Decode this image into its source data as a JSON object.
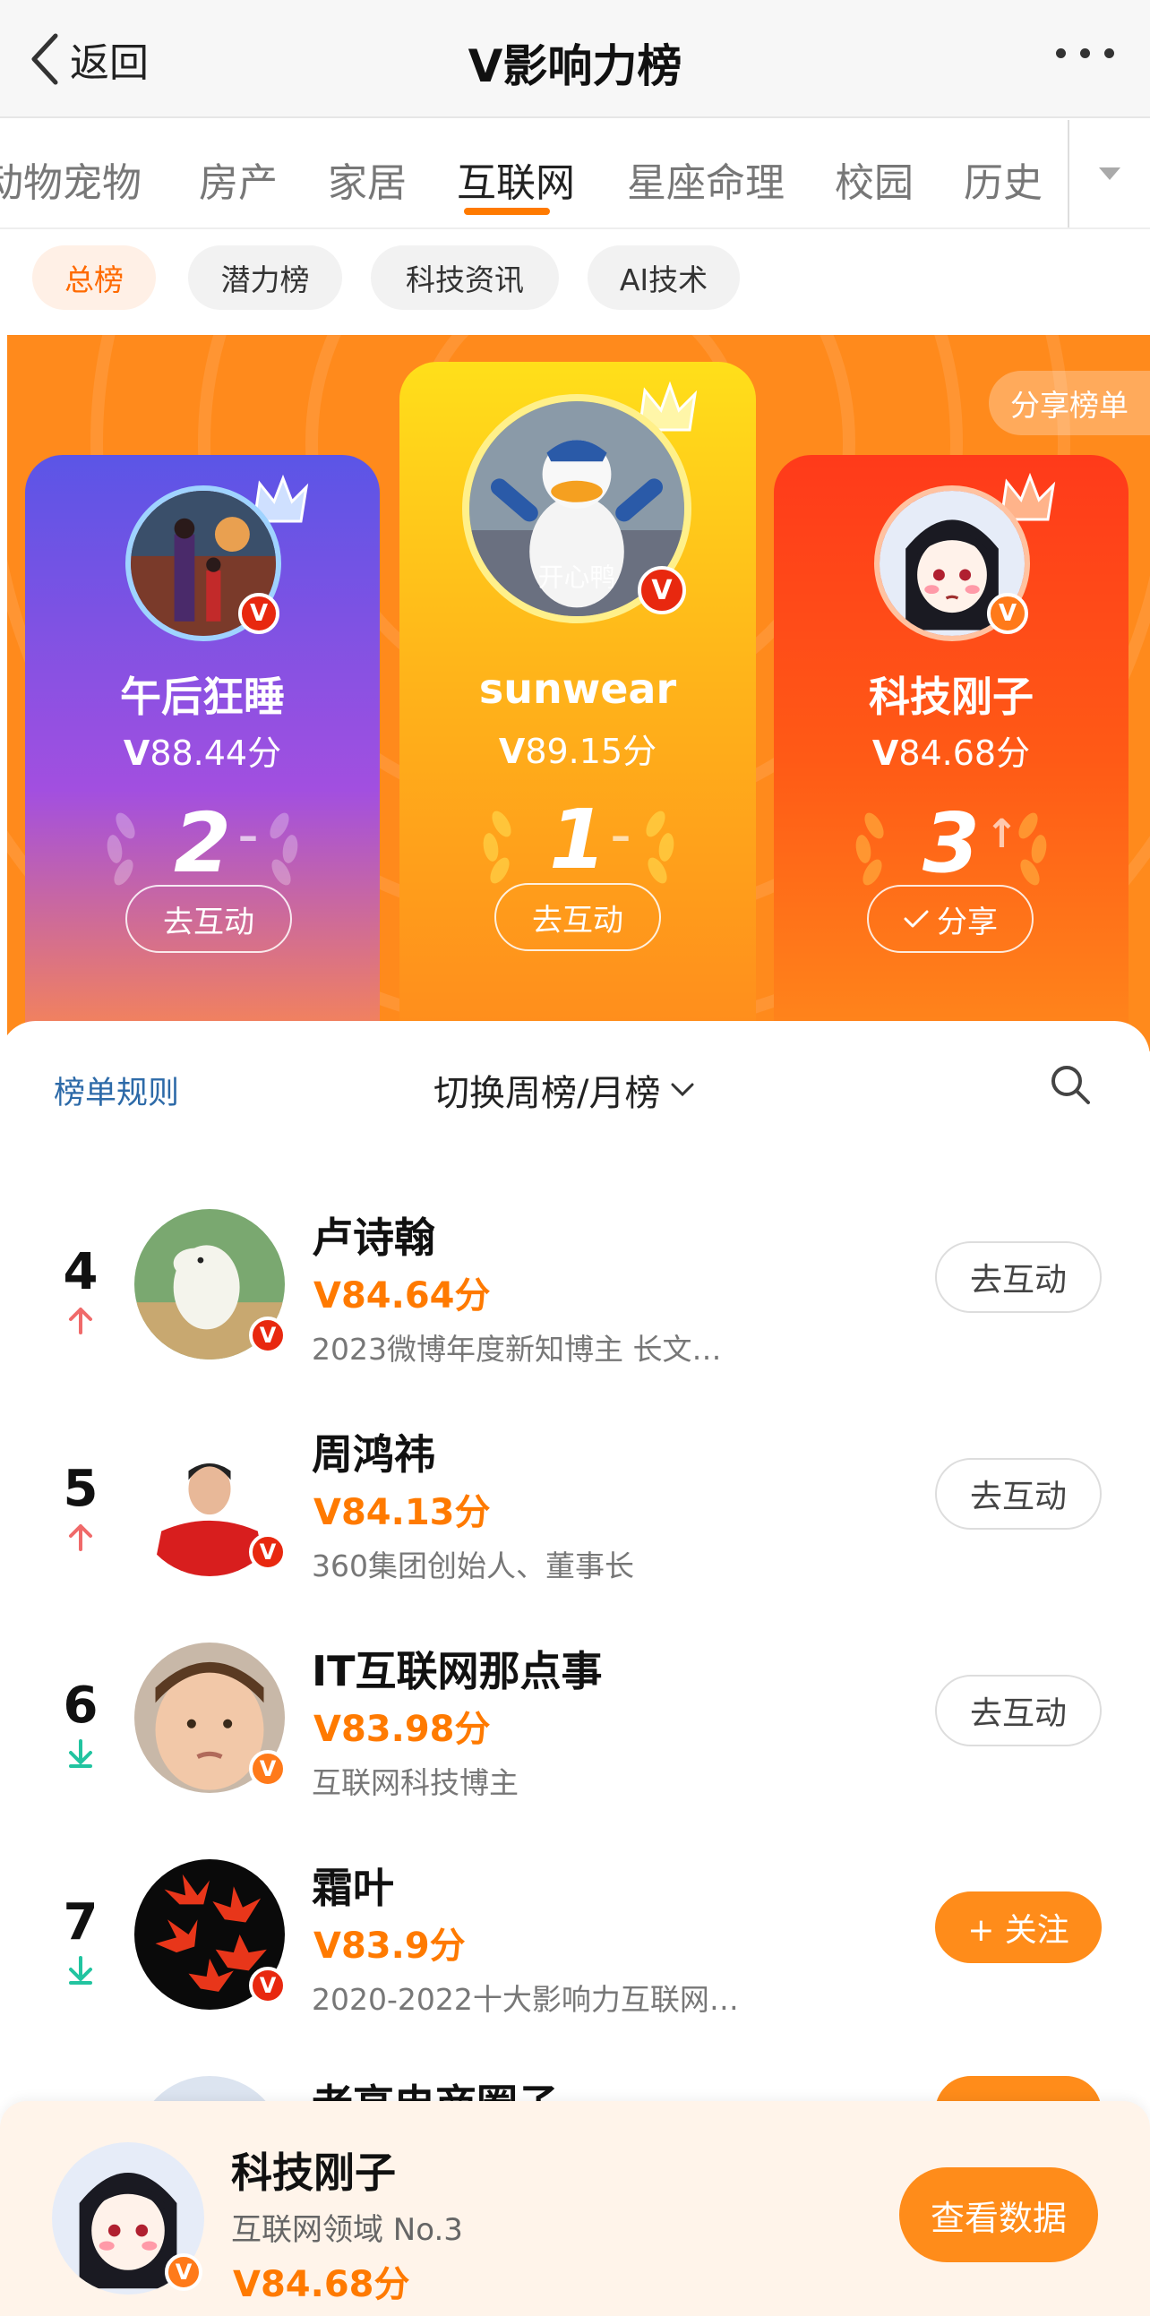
{
  "header": {
    "back_label": "返回",
    "title": "V影响力榜"
  },
  "category_tabs": [
    {
      "label": "动物宠物",
      "active": false
    },
    {
      "label": "房产",
      "active": false
    },
    {
      "label": "家居",
      "active": false
    },
    {
      "label": "互联网",
      "active": true
    },
    {
      "label": "星座命理",
      "active": false
    },
    {
      "label": "校园",
      "active": false
    },
    {
      "label": "历史",
      "active": false
    }
  ],
  "sub_tabs": [
    {
      "label": "总榜",
      "active": true
    },
    {
      "label": "潜力榜",
      "active": false
    },
    {
      "label": "科技资讯",
      "active": false
    },
    {
      "label": "AI技术",
      "active": false
    }
  ],
  "banner": {
    "share_label": "分享榜单",
    "top3": [
      {
        "rank": "2",
        "name": "午后狂睡",
        "score": "88.44分",
        "change": "–",
        "button": "去互动",
        "avatar": "joker-avatar"
      },
      {
        "rank": "1",
        "name": "sunwear",
        "score": "89.15分",
        "change": "–",
        "button": "去互动",
        "avatar": "donald-duck-avatar",
        "avatar_text": "开心鸭"
      },
      {
        "rank": "3",
        "name": "科技刚子",
        "score": "84.68分",
        "change": "↑",
        "button": "分享",
        "avatar": "anime-girl-avatar"
      }
    ]
  },
  "list_header": {
    "rules_label": "榜单规则",
    "switch_label": "切换周榜/月榜"
  },
  "rows": [
    {
      "rank": "4",
      "trend": "up",
      "name": "卢诗翰",
      "score": "84.64分",
      "desc": "2023微博年度新知博主 长文…",
      "button": "去互动",
      "follow": false,
      "badge": "red"
    },
    {
      "rank": "5",
      "trend": "up",
      "name": "周鸿祎",
      "score": "84.13分",
      "desc": "360集团创始人、董事长",
      "button": "去互动",
      "follow": false,
      "badge": "red"
    },
    {
      "rank": "6",
      "trend": "down",
      "name": "IT互联网那点事",
      "score": "83.98分",
      "desc": "互联网科技博主",
      "button": "去互动",
      "follow": false,
      "badge": "orange"
    },
    {
      "rank": "7",
      "trend": "down",
      "name": "霜叶",
      "score": "83.9分",
      "desc": "2020-2022十大影响力互联网…",
      "button": "+ 关注",
      "follow": true,
      "badge": "red"
    },
    {
      "rank": "",
      "trend": "",
      "name": "老高电商圈子",
      "score": "",
      "desc": "",
      "button": "",
      "follow": true,
      "badge": ""
    }
  ],
  "my_rank": {
    "name": "科技刚子",
    "subtitle": "互联网领域 No.3",
    "score": "84.68分",
    "button": "查看数据"
  },
  "colors": {
    "accent": "#ff7a00",
    "up_arrow": "#f06a6a",
    "down_arrow": "#22c4a0",
    "link": "#2d6aa8"
  }
}
